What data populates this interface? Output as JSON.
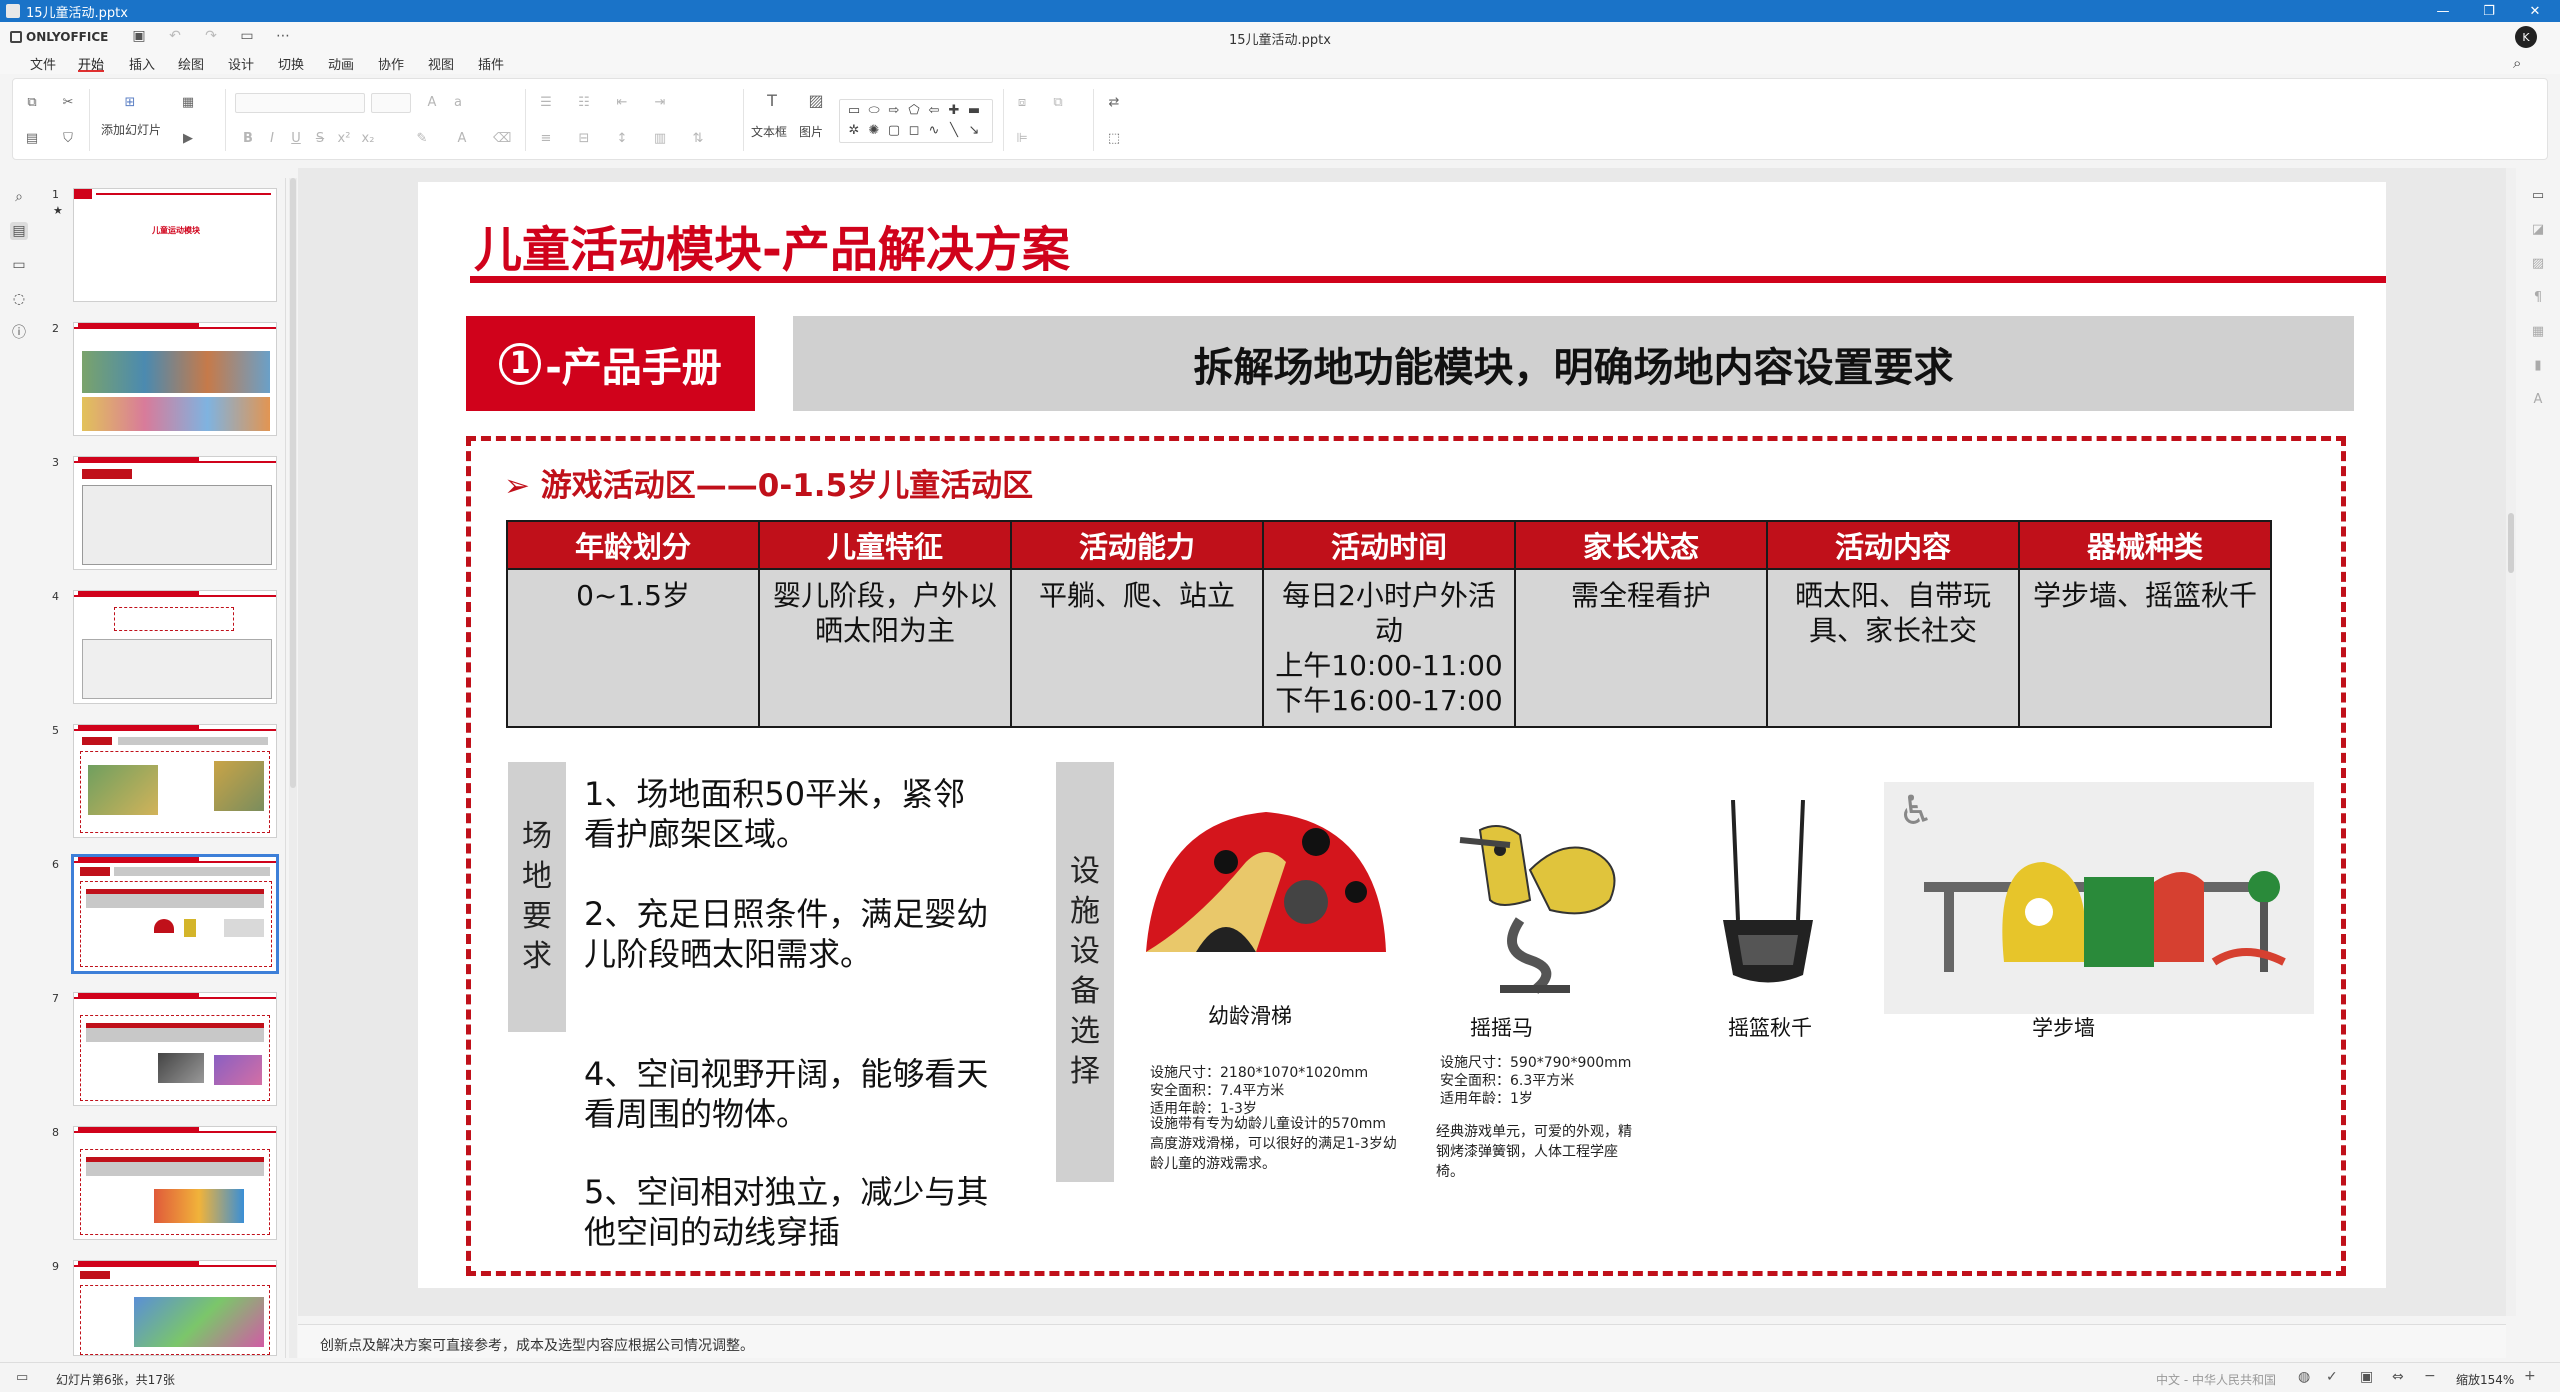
{
  "window": {
    "title": "15儿童活动.pptx",
    "controls": [
      "—",
      "❐",
      "✕"
    ]
  },
  "header": {
    "logo_text": "ONLYOFFICE",
    "doc_title": "15儿童活动.pptx",
    "user_initial": "K"
  },
  "menu": {
    "tabs": [
      "文件",
      "开始",
      "插入",
      "绘图",
      "设计",
      "切换",
      "动画",
      "协作",
      "视图",
      "插件"
    ],
    "active": "开始"
  },
  "toolbar": {
    "add_slide_label": "添加幻灯片",
    "textbox_label": "文本框",
    "image_label": "图片"
  },
  "slides": {
    "numbers": [
      "1",
      "2",
      "3",
      "4",
      "5",
      "6",
      "7",
      "8",
      "9"
    ],
    "selected": 6,
    "thumb1_title": "儿童运动模块"
  },
  "slide": {
    "title": "儿童活动模块-产品解决方案",
    "badge_num": "1",
    "badge_text": "-产品手册",
    "banner": "拆解场地功能模块，明确场地内容设置要求",
    "zone_title": "游戏活动区——0-1.5岁儿童活动区",
    "table": {
      "headers": [
        "年龄划分",
        "儿童特征",
        "活动能力",
        "活动时间",
        "家长状态",
        "活动内容",
        "器械种类"
      ],
      "row": [
        "0~1.5岁",
        "婴儿阶段，户外以晒太阳为主",
        "平躺、爬、站立",
        "每日2小时户外活动\n上午10:00-11:00\n下午16:00-17:00",
        "需全程看护",
        "晒太阳、自带玩具、家长社交",
        "学步墙、摇篮秋千"
      ]
    },
    "site_label": [
      "场",
      "地",
      "要",
      "求"
    ],
    "equip_label": [
      "设",
      "施",
      "设",
      "备",
      "选",
      "择"
    ],
    "requirements": [
      "1、场地面积50平米，紧邻看护廊架区域。",
      "2、充足日照条件，满足婴幼儿阶段晒太阳需求。",
      "4、空间视野开阔，能够看天看周围的物体。",
      "5、空间相对独立，减少与其他空间的动线穿插"
    ],
    "products": [
      {
        "name": "幼龄滑梯",
        "specs": [
          "设施尺寸：2180*1070*1020mm",
          "安全面积：7.4平方米",
          "适用年龄：1-3岁"
        ],
        "desc": "设施带有专为幼龄儿童设计的570mm高度游戏滑梯，可以很好的满足1-3岁幼龄儿童的游戏需求。"
      },
      {
        "name": "摇摇马",
        "specs": [
          "设施尺寸：590*790*900mm",
          "安全面积：6.3平方米",
          "适用年龄：1岁"
        ],
        "desc": "经典游戏单元，可爱的外观，精钢烤漆弹簧钢，人体工程学座椅。"
      },
      {
        "name": "摇篮秋千"
      },
      {
        "name": "学步墙"
      }
    ]
  },
  "notes": "创新点及解决方案可直接参考，成本及选型内容应根据公司情况调整。",
  "status": {
    "slide_counter": "幻灯片第6张，共17张",
    "language": "中文 - 中华人民共和国",
    "zoom": "缩放154%"
  },
  "colors": {
    "brand_red": "#d0021b",
    "titlebar_blue": "#1a73c8"
  }
}
